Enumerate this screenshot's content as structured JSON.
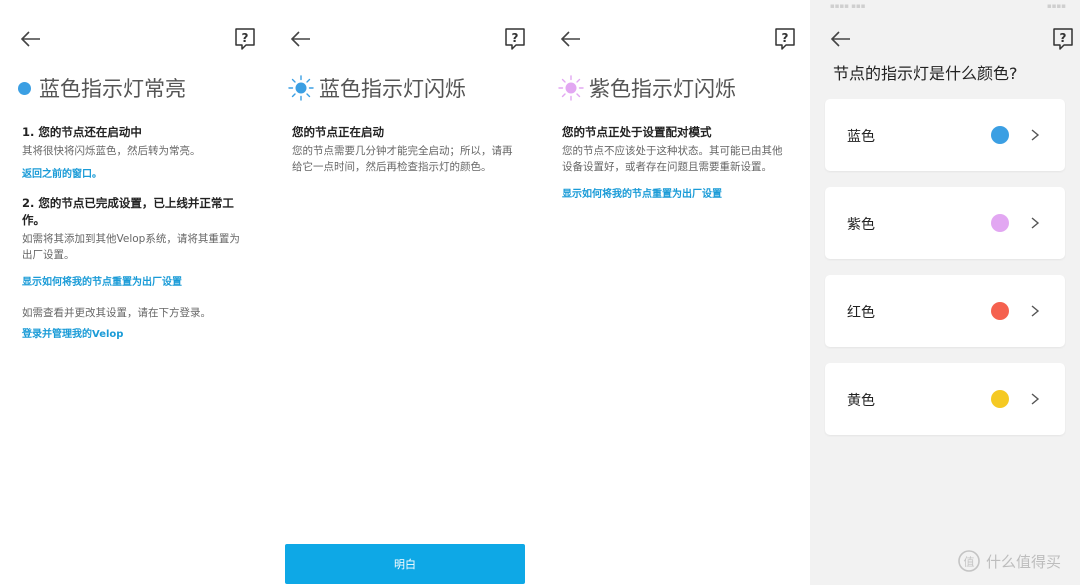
{
  "colors": {
    "blue": "#3b9fe3",
    "purple": "#e2a7f2",
    "red": "#f5614f",
    "yellow": "#f5c923",
    "link": "#1a9bd7",
    "button": "#0ea8e6"
  },
  "panel1": {
    "title": "蓝色指示灯常亮",
    "indicator": "solid",
    "section1": {
      "heading": "1. 您的节点还在启动中",
      "body": "其将很快将闪烁蓝色，然后转为常亮。",
      "link": "返回之前的窗口。"
    },
    "section2": {
      "heading": "2. 您的节点已完成设置，已上线并正常工作。",
      "body": "如需将其添加到其他Velop系统，请将其重置为出厂设置。",
      "link": "显示如何将我的节点重置为出厂设置"
    },
    "section3": {
      "body": "如需查看并更改其设置，请在下方登录。",
      "link": "登录并管理我的Velop"
    }
  },
  "panel2": {
    "title": "蓝色指示灯闪烁",
    "indicator": "flashing",
    "heading": "您的节点正在启动",
    "body": "您的节点需要几分钟才能完全启动；所以，请再给它一点时间，然后再检查指示灯的颜色。",
    "button_label": "明白"
  },
  "panel3": {
    "title": "紫色指示灯闪烁",
    "indicator": "flashing",
    "heading": "您的节点正处于设置配对模式",
    "body": "您的节点不应该处于这种状态。其可能已由其他设备设置好，或者存在问题且需要重新设置。",
    "link": "显示如何将我的节点重置为出厂设置"
  },
  "panel4": {
    "title": "节点的指示灯是什么颜色?",
    "status_left": "▪▪▪▪ ▪▪▪",
    "status_right": "▪▪▪▪",
    "options": [
      {
        "label": "蓝色",
        "color": "#3b9fe3"
      },
      {
        "label": "紫色",
        "color": "#e2a7f2"
      },
      {
        "label": "红色",
        "color": "#f5614f"
      },
      {
        "label": "黄色",
        "color": "#f5c923"
      }
    ],
    "watermark": "什么值得买",
    "watermark_logo": "值"
  },
  "icons": {
    "back": "arrow-left-icon",
    "help": "question-bubble-icon",
    "chevron": "chevron-right-icon",
    "sun": "flashing-light-icon"
  }
}
